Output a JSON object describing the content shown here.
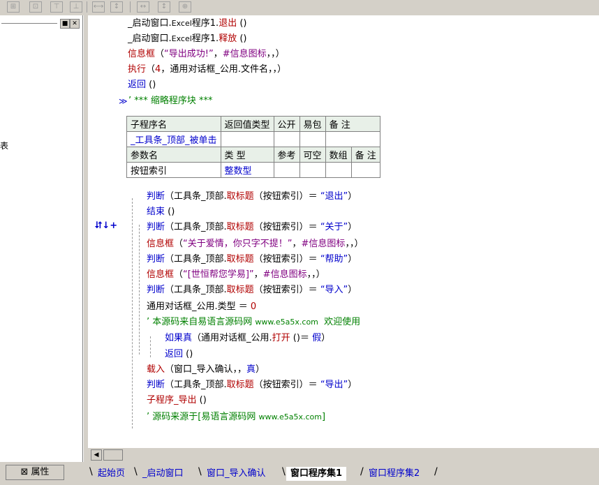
{
  "code": {
    "lines": [
      {
        "parts": [
          {
            "t": "_启动窗口.",
            "c": "blk"
          },
          {
            "t": "Excel",
            "c": "blk small"
          },
          {
            "t": "程序1.",
            "c": "blk"
          },
          {
            "t": "退出",
            "c": "red"
          },
          {
            "t": " ()",
            "c": "blk"
          }
        ]
      },
      {
        "parts": [
          {
            "t": "_启动窗口.",
            "c": "blk"
          },
          {
            "t": "Excel",
            "c": "blk small"
          },
          {
            "t": "程序1.",
            "c": "blk"
          },
          {
            "t": "释放",
            "c": "red"
          },
          {
            "t": " ()",
            "c": "blk"
          }
        ]
      },
      {
        "parts": [
          {
            "t": "信息框",
            "c": "red"
          },
          {
            "t": "（",
            "c": "blk"
          },
          {
            "t": "“导出成功!”",
            "c": "mag"
          },
          {
            "t": "，",
            "c": "blk"
          },
          {
            "t": "#信息图标",
            "c": "mag"
          },
          {
            "t": "，，）",
            "c": "blk"
          }
        ]
      },
      {
        "parts": [
          {
            "t": "执行",
            "c": "red"
          },
          {
            "t": "（",
            "c": "blk"
          },
          {
            "t": "4",
            "c": "red"
          },
          {
            "t": "，通用对话框_公用.文件名，，）",
            "c": "blk"
          }
        ]
      },
      {
        "parts": [
          {
            "t": "返回",
            "c": "blue"
          },
          {
            "t": " ()",
            "c": "blk"
          }
        ]
      },
      {
        "parts": [
          {
            "t": "’ *** 缩略程序块 ***",
            "c": "grn"
          }
        ]
      }
    ],
    "body": [
      {
        "parts": [
          {
            "t": "判断",
            "c": "blue"
          },
          {
            "t": "（工具条_顶部.",
            "c": "blk"
          },
          {
            "t": "取标题",
            "c": "red"
          },
          {
            "t": "（按钮索引）＝ ",
            "c": "blk"
          },
          {
            "t": "“退出”",
            "c": "blue"
          },
          {
            "t": "）",
            "c": "blk"
          }
        ]
      },
      {
        "parts": [
          {
            "t": "结束",
            "c": "blue"
          },
          {
            "t": " ()",
            "c": "blk"
          }
        ]
      },
      {
        "parts": [
          {
            "t": "判断",
            "c": "blue"
          },
          {
            "t": "（工具条_顶部.",
            "c": "blk"
          },
          {
            "t": "取标题",
            "c": "red"
          },
          {
            "t": "（按钮索引）＝ ",
            "c": "blk"
          },
          {
            "t": "“关于”",
            "c": "blue"
          },
          {
            "t": "）",
            "c": "blk"
          }
        ]
      },
      {
        "parts": [
          {
            "t": "信息框",
            "c": "red"
          },
          {
            "t": "（",
            "c": "blk"
          },
          {
            "t": "“关于爱情，你只字不提！”",
            "c": "mag"
          },
          {
            "t": "，",
            "c": "blk"
          },
          {
            "t": "#信息图标",
            "c": "mag"
          },
          {
            "t": "，，）",
            "c": "blk"
          }
        ]
      },
      {
        "parts": [
          {
            "t": "判断",
            "c": "blue"
          },
          {
            "t": "（工具条_顶部.",
            "c": "blk"
          },
          {
            "t": "取标题",
            "c": "red"
          },
          {
            "t": "（按钮索引）＝ ",
            "c": "blk"
          },
          {
            "t": "“帮助”",
            "c": "blue"
          },
          {
            "t": "）",
            "c": "blk"
          }
        ]
      },
      {
        "parts": [
          {
            "t": "信息框",
            "c": "red"
          },
          {
            "t": "（",
            "c": "blk"
          },
          {
            "t": "“[世恒帮您学易]”",
            "c": "mag"
          },
          {
            "t": "，",
            "c": "blk"
          },
          {
            "t": "#信息图标",
            "c": "mag"
          },
          {
            "t": "，，）",
            "c": "blk"
          }
        ]
      },
      {
        "parts": [
          {
            "t": "判断",
            "c": "blue"
          },
          {
            "t": "（工具条_顶部.",
            "c": "blk"
          },
          {
            "t": "取标题",
            "c": "red"
          },
          {
            "t": "（按钮索引）＝ ",
            "c": "blk"
          },
          {
            "t": "“导入”",
            "c": "blue"
          },
          {
            "t": "）",
            "c": "blk"
          }
        ]
      },
      {
        "parts": [
          {
            "t": "通用对话框_公用.类型 ＝ ",
            "c": "blk"
          },
          {
            "t": "0",
            "c": "red"
          }
        ]
      },
      {
        "parts": [
          {
            "t": "’ 本源码来自易语言源码网 ",
            "c": "grn"
          },
          {
            "t": "www.e5a5x.com",
            "c": "grn small"
          },
          {
            "t": "  欢迎使用",
            "c": "grn"
          }
        ]
      },
      {
        "parts": [
          {
            "t": "如果真",
            "c": "blue"
          },
          {
            "t": "（通用对话框_公用.",
            "c": "blk"
          },
          {
            "t": "打开",
            "c": "red"
          },
          {
            "t": " ()＝ ",
            "c": "blk"
          },
          {
            "t": "假",
            "c": "blue"
          },
          {
            "t": "）",
            "c": "blk"
          }
        ]
      },
      {
        "parts": [
          {
            "t": "返回",
            "c": "blue"
          },
          {
            "t": " ()",
            "c": "blk"
          }
        ]
      },
      {
        "parts": [
          {
            "t": "载入",
            "c": "red"
          },
          {
            "t": "（窗口_导入确认，，",
            "c": "blk"
          },
          {
            "t": "真",
            "c": "blue"
          },
          {
            "t": "）",
            "c": "blk"
          }
        ]
      },
      {
        "parts": [
          {
            "t": "判断",
            "c": "blue"
          },
          {
            "t": "（工具条_顶部.",
            "c": "blk"
          },
          {
            "t": "取标题",
            "c": "red"
          },
          {
            "t": "（按钮索引）＝ ",
            "c": "blk"
          },
          {
            "t": "“导出”",
            "c": "blue"
          },
          {
            "t": "）",
            "c": "blk"
          }
        ]
      },
      {
        "parts": [
          {
            "t": "子程序_导出",
            "c": "red"
          },
          {
            "t": " ()",
            "c": "blk"
          }
        ]
      },
      {
        "parts": [
          {
            "t": "’ 源码来源于[易语言源码网 ",
            "c": "grn"
          },
          {
            "t": "www.e5a5x.com",
            "c": "grn small"
          },
          {
            "t": "]",
            "c": "grn"
          }
        ]
      }
    ]
  },
  "sub_table": {
    "header1": [
      "子程序名",
      "返回值类型",
      "公开",
      "易包",
      "备 注"
    ],
    "name": "_工具条_顶部_被单击",
    "header2": [
      "参数名",
      "类 型",
      "参考",
      "可空",
      "数组",
      "备 注"
    ],
    "param_name": "按钮索引",
    "param_type": "整数型"
  },
  "gutter": {
    "marker": "⮃↓+"
  },
  "left_pane": {
    "fragment": "表"
  },
  "props_button": "属性",
  "tabs": [
    "起始页",
    "_启动窗口",
    "窗口_导入确认",
    "窗口程序集1",
    "窗口程序集2"
  ],
  "active_tab": "窗口程序集1",
  "colors": {
    "blue": "#0000cc",
    "red": "#b00000",
    "green": "#008000",
    "magenta": "#800080"
  }
}
